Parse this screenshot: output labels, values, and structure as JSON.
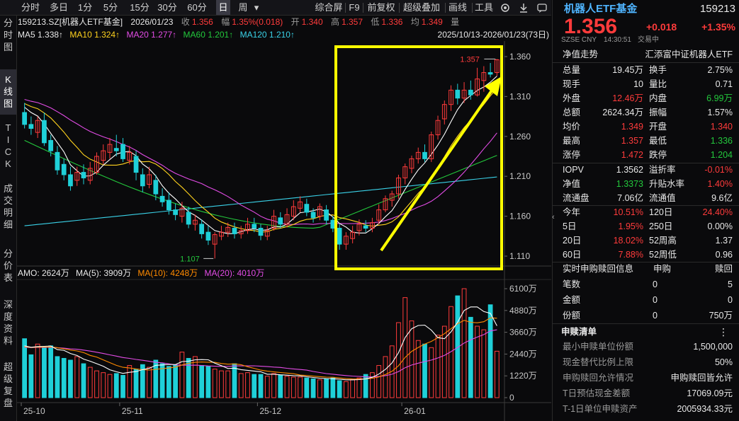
{
  "toolbar": {
    "items": [
      "分时",
      "多日",
      "1分",
      "5分",
      "15分",
      "30分",
      "60分",
      "日",
      "周"
    ],
    "more": "▾",
    "right": [
      "综合屏",
      "F9",
      "前复权",
      "超级叠加",
      "画线",
      "工具"
    ]
  },
  "lefttabs": [
    [
      "分",
      "时",
      "图"
    ],
    [
      "K",
      "线",
      "图"
    ],
    [
      "T",
      "I",
      "C",
      "K"
    ],
    [
      "成",
      "交",
      "明",
      "细"
    ],
    [
      "分",
      "价",
      "表"
    ],
    [
      "深",
      "度",
      "资",
      "料"
    ],
    [
      "超",
      "级",
      "复",
      "盘"
    ]
  ],
  "info": {
    "code": "159213.SZ[机器人ETF基金]",
    "date": "2026/01/23",
    "close_label": "收",
    "close": "1.356",
    "chg_label": "幅",
    "chg": "1.35%(0.018)",
    "open_label": "开",
    "open": "1.340",
    "high_label": "高",
    "high": "1.357",
    "low_label": "低",
    "low": "1.336",
    "avg_label": "均",
    "avg": "1.349",
    "vol_label": "量",
    "range": "2025/10/13-2026/01/23(73日)"
  },
  "ma": {
    "ma5": "MA5 1.338↑",
    "ma10": "MA10 1.324↑",
    "ma20": "MA20 1.277↑",
    "ma60": "MA60 1.201↑",
    "ma120": "MA120 1.210↑"
  },
  "vol": {
    "amo": "AMO: 2624万",
    "ma5": "MA(5): 3909万",
    "ma10": "MA(10): 4248万",
    "ma20": "MA(20): 4010万"
  },
  "colors": {
    "up": "#ff3b3b",
    "down": "#1fd0d8",
    "ma5": "#ffffff",
    "ma10": "#ffd21e",
    "ma20": "#e34ce6",
    "ma60": "#23c83c",
    "ma120": "#3ad2e8",
    "highlight": "#ffff00"
  },
  "chart_data": {
    "type": "candlestick",
    "price_ticks": [
      "1.360",
      "1.310",
      "1.260",
      "1.210",
      "1.160",
      "1.110"
    ],
    "price_tick_values": [
      1.36,
      1.31,
      1.26,
      1.21,
      1.16,
      1.11
    ],
    "vol_ticks": [
      "6100万",
      "4880万",
      "3660万",
      "2440万",
      "1220万",
      "0"
    ],
    "vol_tick_values": [
      6100,
      4880,
      3660,
      2440,
      1220,
      0
    ],
    "dates": [
      "25-10",
      "25-11",
      "25-12",
      "26-01"
    ],
    "date_index": [
      0,
      15,
      36,
      58
    ],
    "high_label": "1.357",
    "low_label": "1.107",
    "ohlc": [
      [
        1.29,
        1.275,
        1.302,
        1.27
      ],
      [
        1.275,
        1.27,
        1.285,
        1.262
      ],
      [
        1.265,
        1.28,
        1.285,
        1.258
      ],
      [
        1.28,
        1.252,
        1.29,
        1.248
      ],
      [
        1.255,
        1.242,
        1.262,
        1.235
      ],
      [
        1.24,
        1.218,
        1.248,
        1.212
      ],
      [
        1.225,
        1.212,
        1.232,
        1.205
      ],
      [
        1.212,
        1.198,
        1.222,
        1.192
      ],
      [
        1.205,
        1.215,
        1.222,
        1.198
      ],
      [
        1.215,
        1.208,
        1.225,
        1.2
      ],
      [
        1.205,
        1.22,
        1.228,
        1.2
      ],
      [
        1.215,
        1.235,
        1.24,
        1.212
      ],
      [
        1.23,
        1.242,
        1.25,
        1.225
      ],
      [
        1.24,
        1.25,
        1.258,
        1.232
      ],
      [
        1.245,
        1.242,
        1.262,
        1.235
      ],
      [
        1.25,
        1.232,
        1.258,
        1.228
      ],
      [
        1.23,
        1.24,
        1.248,
        1.225
      ],
      [
        1.235,
        1.215,
        1.242,
        1.205
      ],
      [
        1.212,
        1.198,
        1.22,
        1.19
      ],
      [
        1.2,
        1.212,
        1.222,
        1.195
      ],
      [
        1.205,
        1.188,
        1.212,
        1.18
      ],
      [
        1.185,
        1.178,
        1.195,
        1.172
      ],
      [
        1.18,
        1.168,
        1.19,
        1.162
      ],
      [
        1.168,
        1.162,
        1.176,
        1.155
      ],
      [
        1.16,
        1.17,
        1.178,
        1.152
      ],
      [
        1.165,
        1.15,
        1.172,
        1.145
      ],
      [
        1.15,
        1.155,
        1.162,
        1.142
      ],
      [
        1.15,
        1.138,
        1.156,
        1.132
      ],
      [
        1.14,
        1.13,
        1.148,
        1.124
      ],
      [
        1.125,
        1.137,
        1.14,
        1.107
      ],
      [
        1.135,
        1.14,
        1.148,
        1.13
      ],
      [
        1.14,
        1.146,
        1.152,
        1.134
      ],
      [
        1.145,
        1.138,
        1.152,
        1.132
      ],
      [
        1.138,
        1.142,
        1.148,
        1.132
      ],
      [
        1.142,
        1.15,
        1.158,
        1.138
      ],
      [
        1.15,
        1.145,
        1.158,
        1.14
      ],
      [
        1.145,
        1.136,
        1.15,
        1.13
      ],
      [
        1.135,
        1.142,
        1.148,
        1.13
      ],
      [
        1.145,
        1.16,
        1.168,
        1.142
      ],
      [
        1.158,
        1.15,
        1.165,
        1.145
      ],
      [
        1.15,
        1.162,
        1.17,
        1.146
      ],
      [
        1.16,
        1.172,
        1.18,
        1.155
      ],
      [
        1.17,
        1.178,
        1.185,
        1.165
      ],
      [
        1.175,
        1.165,
        1.182,
        1.16
      ],
      [
        1.165,
        1.158,
        1.17,
        1.152
      ],
      [
        1.16,
        1.172,
        1.176,
        1.155
      ],
      [
        1.168,
        1.155,
        1.174,
        1.15
      ],
      [
        1.155,
        1.145,
        1.16,
        1.14
      ],
      [
        1.145,
        1.125,
        1.15,
        1.118
      ],
      [
        1.125,
        1.135,
        1.14,
        1.118
      ],
      [
        1.132,
        1.14,
        1.148,
        1.126
      ],
      [
        1.142,
        1.15,
        1.156,
        1.136
      ],
      [
        1.148,
        1.145,
        1.155,
        1.14
      ],
      [
        1.145,
        1.152,
        1.158,
        1.14
      ],
      [
        1.155,
        1.168,
        1.175,
        1.15
      ],
      [
        1.168,
        1.182,
        1.186,
        1.165
      ],
      [
        1.18,
        1.188,
        1.192,
        1.172
      ],
      [
        1.188,
        1.208,
        1.212,
        1.182
      ],
      [
        1.208,
        1.222,
        1.226,
        1.2
      ],
      [
        1.22,
        1.232,
        1.236,
        1.214
      ],
      [
        1.232,
        1.24,
        1.246,
        1.226
      ],
      [
        1.24,
        1.232,
        1.25,
        1.228
      ],
      [
        1.232,
        1.262,
        1.266,
        1.228
      ],
      [
        1.262,
        1.28,
        1.286,
        1.256
      ],
      [
        1.282,
        1.3,
        1.305,
        1.275
      ],
      [
        1.3,
        1.318,
        1.324,
        1.292
      ],
      [
        1.318,
        1.308,
        1.326,
        1.3
      ],
      [
        1.308,
        1.318,
        1.328,
        1.302
      ],
      [
        1.318,
        1.312,
        1.33,
        1.306
      ],
      [
        1.312,
        1.332,
        1.346,
        1.31
      ],
      [
        1.33,
        1.34,
        1.348,
        1.316
      ],
      [
        1.34,
        1.338,
        1.352,
        1.334
      ],
      [
        1.34,
        1.356,
        1.357,
        1.336
      ]
    ],
    "volume": [
      3300,
      2400,
      3000,
      2850,
      2900,
      2300,
      2200,
      2100,
      2300,
      1900,
      1700,
      1500,
      1400,
      1300,
      1350,
      1250,
      1800,
      1600,
      1850,
      1700,
      2100,
      1900,
      1750,
      1800,
      2550,
      2200,
      2300,
      1800,
      1750,
      1600,
      1500,
      1500,
      1900,
      1350,
      1400,
      1300,
      1300,
      1200,
      1350,
      1250,
      1200,
      1150,
      1150,
      1100,
      1050,
      1000,
      1050,
      1100,
      950,
      900,
      1000,
      1100,
      1300,
      1400,
      1800,
      2300,
      2900,
      4200,
      5600,
      4300,
      3200,
      3000,
      2800,
      3500,
      4000,
      5100,
      5700,
      6100,
      4500,
      4000,
      3800,
      5200,
      2600
    ]
  },
  "right": {
    "name": "机器人ETF基金",
    "code": "159213",
    "price": "1.356",
    "chg": "+0.018",
    "chgpct": "+1.35%",
    "market": "SZSE CNY",
    "time": "14:30:51",
    "status": "交易中",
    "nav_trend": "净值走势",
    "index_name": "汇添富中证机器人ETF",
    "stats": [
      [
        "总量",
        "19.45万",
        "换手",
        "2.75%"
      ],
      [
        "现手",
        "10",
        "量比",
        "0.71"
      ],
      [
        "外盘",
        "12.46万",
        "内盘",
        "6.99万"
      ],
      [
        "总额",
        "2624.34万",
        "振幅",
        "1.57%"
      ],
      [
        "均价",
        "1.349",
        "开盘",
        "1.340"
      ],
      [
        "最高",
        "1.357",
        "最低",
        "1.336"
      ],
      [
        "涨停",
        "1.472",
        "跌停",
        "1.204"
      ]
    ],
    "stats2": [
      [
        "IOPV",
        "1.3562",
        "溢折率",
        "-0.01%"
      ],
      [
        "净值",
        "1.3373",
        "升贴水率",
        "1.40%"
      ],
      [
        "流通盘",
        "7.06亿",
        "流通值",
        "9.6亿"
      ]
    ],
    "returns": [
      [
        "今年",
        "10.51%",
        "120日",
        "24.40%"
      ],
      [
        "5日",
        "1.95%",
        "250日",
        "0.00%"
      ],
      [
        "20日",
        "18.02%",
        "52周高",
        "1.37"
      ],
      [
        "60日",
        "7.88%",
        "52周低",
        "0.96"
      ]
    ],
    "realtime_title": "实时申购赎回信息",
    "realtime_cols": [
      "申购",
      "赎回"
    ],
    "realtime": [
      [
        "笔数",
        "0",
        "5"
      ],
      [
        "金额",
        "0",
        "0"
      ],
      [
        "份额",
        "0",
        "750万"
      ]
    ],
    "list_title": "申赎清单",
    "list": [
      [
        "最小申赎单位份额",
        "1,500,000"
      ],
      [
        "现金替代比例上限",
        "50%"
      ],
      [
        "申购赎回允许情况",
        "申购赎回皆允许"
      ],
      [
        "T日预估现金差额",
        "17069.09元"
      ],
      [
        "T-1日单位申赎资产",
        "2005934.33元"
      ]
    ],
    "more": "⋮"
  }
}
